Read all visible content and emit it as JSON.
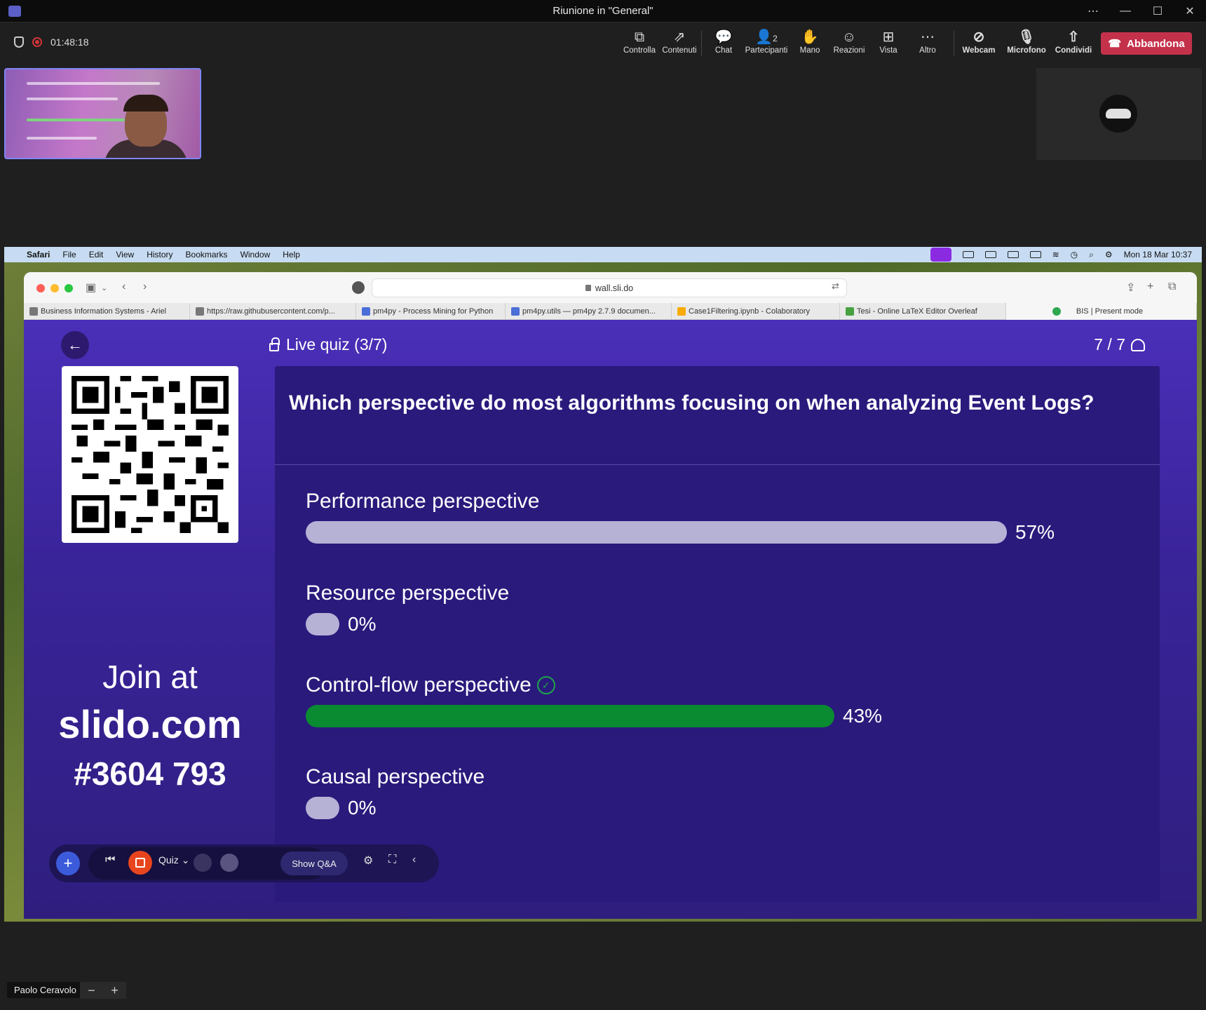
{
  "window": {
    "title": "Riunione in \"General\""
  },
  "meeting": {
    "timer": "01:48:18",
    "buttons": {
      "control": "Controlla",
      "content": "Contenuti",
      "chat": "Chat",
      "participants": "Partecipanti",
      "participants_count": "2",
      "hand": "Mano",
      "reactions": "Reazioni",
      "view": "Vista",
      "more": "Altro",
      "webcam": "Webcam",
      "mic": "Microfono",
      "share": "Condividi",
      "leave": "Abbandona"
    },
    "presenter_name": "Paolo Ceravolo"
  },
  "macos": {
    "menu": [
      "Safari",
      "File",
      "Edit",
      "View",
      "History",
      "Bookmarks",
      "Window",
      "Help"
    ],
    "clock": "Mon 18 Mar  10:37"
  },
  "safari": {
    "url": "wall.sli.do",
    "tabs": [
      "Business Information Systems - Ariel",
      "https://raw.githubusercontent.com/p...",
      "pm4py - Process Mining for Python",
      "pm4py.utils — pm4py 2.7.9 documen...",
      "Case1Filtering.ipynb - Colaboratory",
      "Tesi - Online LaTeX Editor Overleaf",
      "BIS | Present mode"
    ]
  },
  "slido": {
    "quiz_title": "Live quiz (3/7)",
    "counter": "7 / 7",
    "join_line1": "Join at",
    "join_line2": "slido.com",
    "join_code": "#3604 793",
    "question": "Which perspective do most algorithms focusing on when analyzing Event Logs?",
    "options": [
      {
        "label": "Performance perspective",
        "percent": "57%",
        "value": 57,
        "correct": false
      },
      {
        "label": "Resource perspective",
        "percent": "0%",
        "value": 0,
        "correct": false
      },
      {
        "label": "Control-flow perspective",
        "percent": "43%",
        "value": 43,
        "correct": true
      },
      {
        "label": "Causal perspective",
        "percent": "0%",
        "value": 0,
        "correct": false
      }
    ],
    "presenter_bar": {
      "mode": "Quiz",
      "show_qa": "Show Q&A"
    }
  },
  "colors": {
    "accent": "#4a2fb8",
    "correct": "#0a8a31",
    "leave": "#c4314b"
  }
}
